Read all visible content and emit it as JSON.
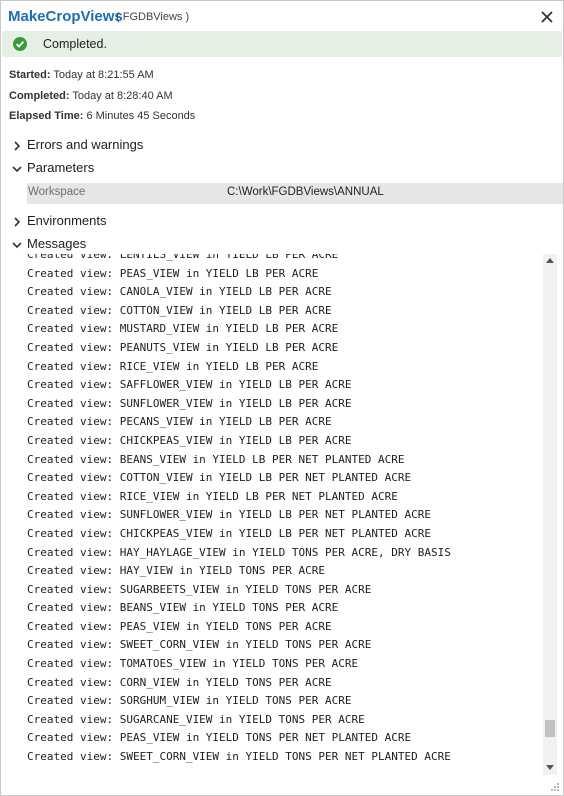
{
  "title": {
    "tool_name": "MakeCropViews",
    "subtitle": "( FGDBViews )"
  },
  "status": {
    "text": "Completed.",
    "icon": "check-circle-icon",
    "color": "#3a9a3a"
  },
  "meta": {
    "started_label": "Started:",
    "started_value": "Today at 8:21:55 AM",
    "completed_label": "Completed:",
    "completed_value": "Today at 8:28:40 AM",
    "elapsed_label": "Elapsed Time:",
    "elapsed_value": "6 Minutes 45 Seconds"
  },
  "sections": {
    "errors": "Errors and warnings",
    "parameters": "Parameters",
    "environments": "Environments",
    "messages": "Messages"
  },
  "parameters": [
    {
      "name": "Workspace",
      "value": "C:\\Work\\FGDBViews\\ANNUAL"
    }
  ],
  "messages": [
    "Created view: LENTILS_VIEW in YIELD LB PER ACRE",
    "Created view: PEAS_VIEW in YIELD LB PER ACRE",
    "Created view: CANOLA_VIEW in YIELD LB PER ACRE",
    "Created view: COTTON_VIEW in YIELD LB PER ACRE",
    "Created view: MUSTARD_VIEW in YIELD LB PER ACRE",
    "Created view: PEANUTS_VIEW in YIELD LB PER ACRE",
    "Created view: RICE_VIEW in YIELD LB PER ACRE",
    "Created view: SAFFLOWER_VIEW in YIELD LB PER ACRE",
    "Created view: SUNFLOWER_VIEW in YIELD LB PER ACRE",
    "Created view: PECANS_VIEW in YIELD LB PER ACRE",
    "Created view: CHICKPEAS_VIEW in YIELD LB PER ACRE",
    "Created view: BEANS_VIEW in YIELD LB PER NET PLANTED ACRE",
    "Created view: COTTON_VIEW in YIELD LB PER NET PLANTED ACRE",
    "Created view: RICE_VIEW in YIELD LB PER NET PLANTED ACRE",
    "Created view: SUNFLOWER_VIEW in YIELD LB PER NET PLANTED ACRE",
    "Created view: CHICKPEAS_VIEW in YIELD LB PER NET PLANTED ACRE",
    "Created view: HAY_HAYLAGE_VIEW in YIELD TONS PER ACRE, DRY BASIS",
    "Created view: HAY_VIEW in YIELD TONS PER ACRE",
    "Created view: SUGARBEETS_VIEW in YIELD TONS PER ACRE",
    "Created view: BEANS_VIEW in YIELD TONS PER ACRE",
    "Created view: PEAS_VIEW in YIELD TONS PER ACRE",
    "Created view: SWEET_CORN_VIEW in YIELD TONS PER ACRE",
    "Created view: TOMATOES_VIEW in YIELD TONS PER ACRE",
    "Created view: CORN_VIEW in YIELD TONS PER ACRE",
    "Created view: SORGHUM_VIEW in YIELD TONS PER ACRE",
    "Created view: SUGARCANE_VIEW in YIELD TONS PER ACRE",
    "Created view: PEAS_VIEW in YIELD TONS PER NET PLANTED ACRE",
    "Created view: SWEET_CORN_VIEW in YIELD TONS PER NET PLANTED ACRE"
  ],
  "colors": {
    "accent": "#1d6fb0",
    "status_bg": "#e5efe4",
    "param_bg": "#e6e6e6"
  },
  "icons": {
    "close": "close-icon",
    "collapsed": "chevron-right-icon",
    "expanded": "chevron-down-icon",
    "resize": "resize-grip-icon"
  },
  "scroll_position": 0.95
}
